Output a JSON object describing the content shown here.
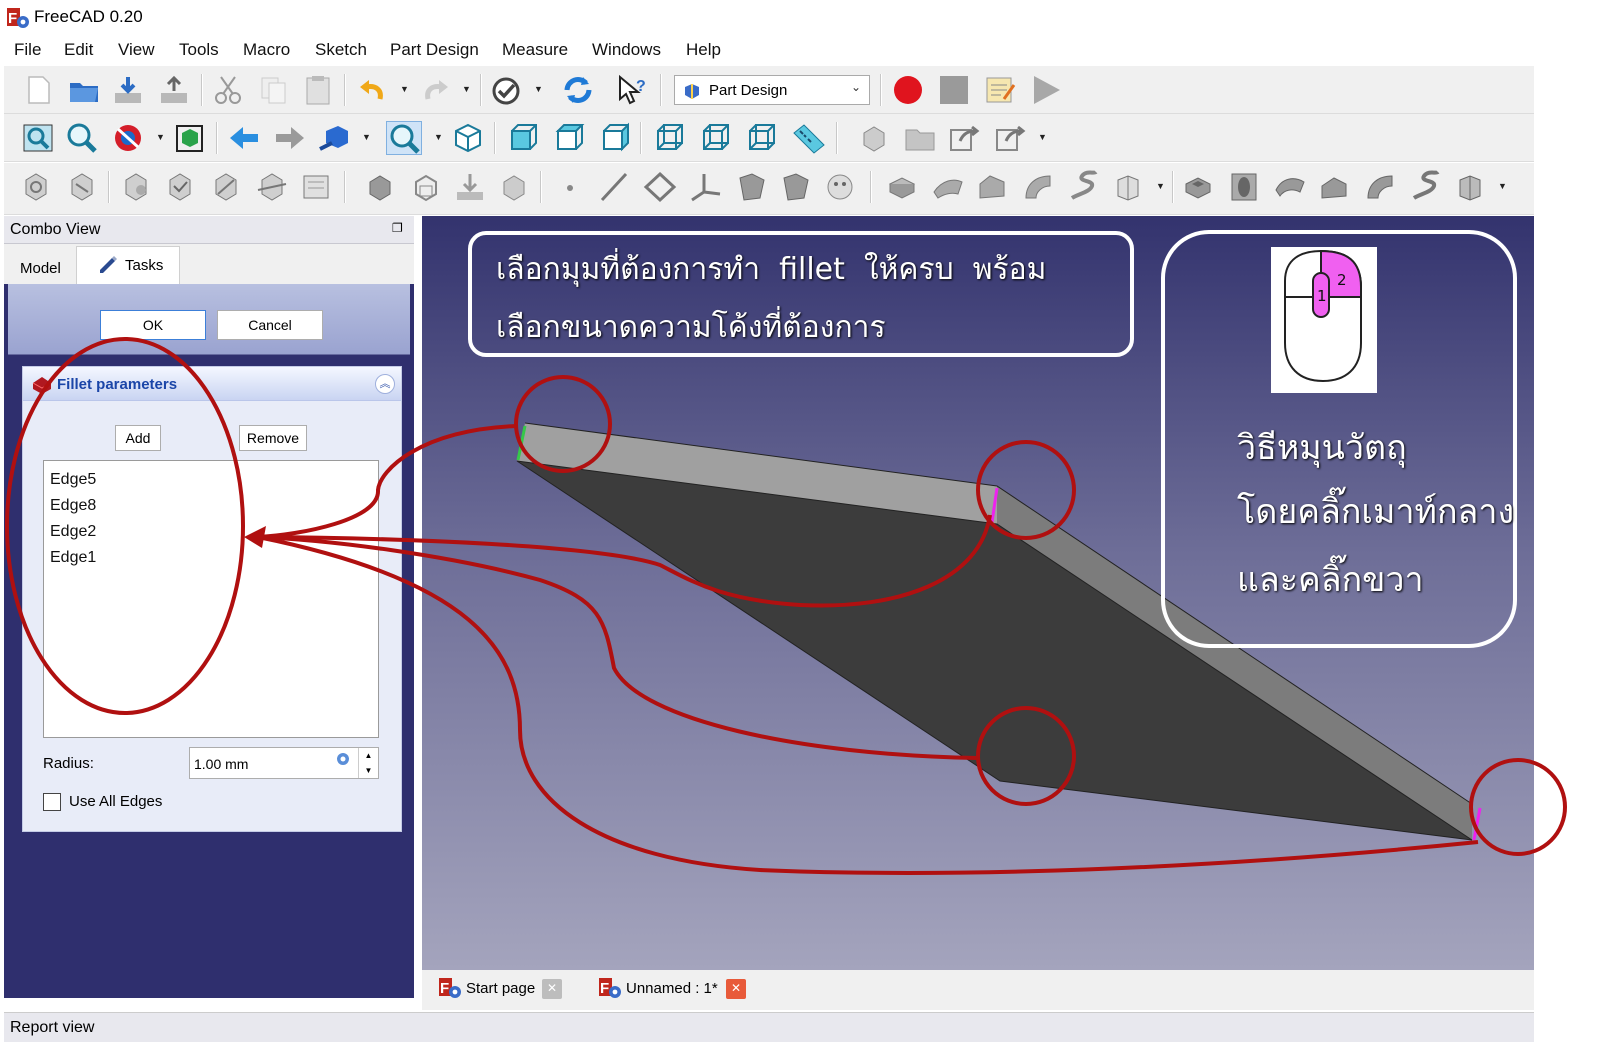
{
  "window": {
    "title": "FreeCAD 0.20"
  },
  "menu": [
    "File",
    "Edit",
    "View",
    "Tools",
    "Macro",
    "Sketch",
    "Part Design",
    "Measure",
    "Windows",
    "Help"
  ],
  "toolbar": {
    "workbench": "Part Design"
  },
  "icons": {
    "tb1": [
      "new-document-icon",
      "open-icon",
      "save-icon",
      "save-as-icon",
      "cut-icon",
      "copy-icon",
      "paste-icon",
      "undo-icon",
      "redo-icon",
      "std-refresh-icon",
      "recompute-icon",
      "whats-this-icon",
      "macro-record-icon",
      "macro-stop-icon",
      "macro-edit-icon",
      "macro-run-icon"
    ],
    "tb2": [
      "fit-all-icon",
      "fit-selection-icon",
      "draw-style-icon",
      "bounding-box-icon",
      "back-icon",
      "forward-icon",
      "sync-view-icon",
      "zoom-select-icon",
      "view-isometric-icon",
      "view-front-icon",
      "view-top-icon",
      "view-right-icon",
      "view-rear-icon",
      "view-bottom-icon",
      "view-left-icon",
      "measure-distance-icon",
      "part-icon",
      "group-icon",
      "link-icon",
      "link-actions-icon"
    ],
    "tb3": [
      "body-icon",
      "sketch-icon",
      "validate-sketch-icon",
      "check-geometry-icon",
      "create-sub-object-icon",
      "datum-icon",
      "clone-icon",
      "shape-binder-icon",
      "sub-shape-binder-icon",
      "create-body-icon",
      "create-part-icon",
      "import-icon",
      "export-icon",
      "datum-point-icon",
      "datum-line-icon",
      "datum-plane-icon",
      "local-coordinate-system-icon",
      "shape-binder-2-icon",
      "sub-shape-binder-2-icon",
      "clone-2-icon",
      "pad-icon",
      "revolution-icon",
      "loft-icon",
      "pipe-icon",
      "helix-icon",
      "additive-primitive-icon",
      "pocket-icon",
      "hole-icon",
      "groove-icon",
      "subtractive-loft-icon",
      "subtractive-pipe-icon",
      "subtractive-helix-icon",
      "subtractive-primitive-icon"
    ]
  },
  "combo_view": {
    "title": "Combo View",
    "tabs": {
      "model": "Model",
      "tasks": "Tasks"
    },
    "ok": "OK",
    "cancel": "Cancel",
    "fillet": {
      "title": "Fillet parameters",
      "add": "Add",
      "remove": "Remove",
      "edges": [
        "Edge5",
        "Edge8",
        "Edge2",
        "Edge1"
      ],
      "radius_label": "Radius:",
      "radius_value": "1.00 mm",
      "use_all_edges": "Use All Edges",
      "use_all_edges_checked": false
    }
  },
  "doc_tabs": [
    "Start page",
    "Unnamed : 1*"
  ],
  "report_view": {
    "title": "Report view"
  },
  "callouts": {
    "instruction_line1": "เลือกมุมที่ต้องการทำ  fillet  ให้ครบ  พร้อม",
    "instruction_line2": "เลือกขนาดความโค้งที่ต้องการ",
    "mouse_num_1": "1",
    "mouse_num_2": "2",
    "rotate_line1": "วิธีหมุนวัตถุ",
    "rotate_line2": "โดยคลิ๊กเมาท์กลาง",
    "rotate_line3": "และคลิ๊กขวา"
  },
  "colors": {
    "annotation_red": "#b01010",
    "highlight_magenta": "#ee22ee",
    "accent_blue": "#1b46a8",
    "viewport_top": "#33336e",
    "viewport_bottom": "#a4a4bd"
  }
}
